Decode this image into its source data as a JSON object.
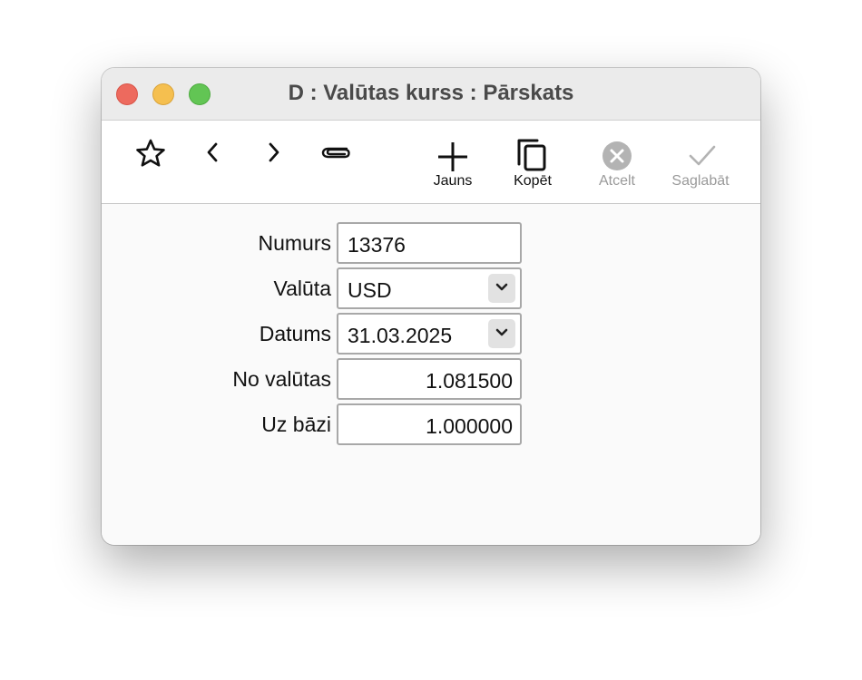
{
  "window": {
    "title": "D : Valūtas kurss : Pārskats"
  },
  "toolbar": {
    "icons": [
      "star-icon",
      "chevron-left-icon",
      "chevron-right-icon",
      "paperclip-icon"
    ],
    "new_label": "Jauns",
    "copy_label": "Kopēt",
    "cancel_label": "Atcelt",
    "save_label": "Saglabāt"
  },
  "form": {
    "number_label": "Numurs",
    "number_value": "13376",
    "currency_label": "Valūta",
    "currency_value": "USD",
    "date_label": "Datums",
    "date_value": "31.03.2025",
    "from_currency_label": "No valūtas",
    "from_currency_value": "1.081500",
    "to_base_label": "Uz bāzi",
    "to_base_value": "1.000000"
  },
  "colors": {
    "close": "#ed6a5e",
    "minimize": "#f5bf4f",
    "maximize": "#62c554",
    "disabled_text": "#9a9a9a"
  }
}
